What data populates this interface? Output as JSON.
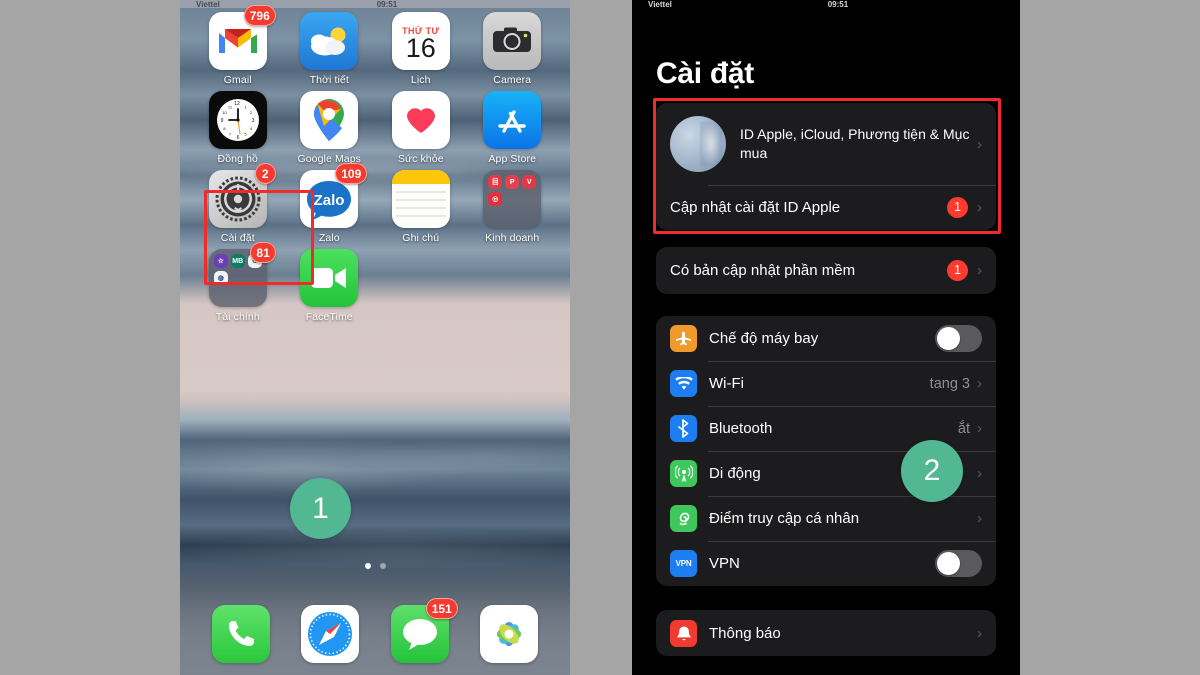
{
  "background_color": "#a5a5a5",
  "left_phone": {
    "name": "ios-home-screen",
    "status_bar": {
      "carrier": "Viettel",
      "time": "09:51",
      "battery": ""
    },
    "apps_rows": [
      [
        {
          "label": "Gmail",
          "icon": "gmail-icon",
          "badge": "796"
        },
        {
          "label": "Thời tiết",
          "icon": "weather-icon",
          "badge": ""
        },
        {
          "label": "Lịch",
          "icon": "calendar-icon",
          "badge": "",
          "cal_weekday": "THỨ TƯ",
          "cal_day": "16"
        },
        {
          "label": "Camera",
          "icon": "camera-icon",
          "badge": ""
        }
      ],
      [
        {
          "label": "Đồng hồ",
          "icon": "clock-icon",
          "badge": ""
        },
        {
          "label": "Google Maps",
          "icon": "google-maps-icon",
          "badge": ""
        },
        {
          "label": "Sức khỏe",
          "icon": "health-icon",
          "badge": ""
        },
        {
          "label": "App Store",
          "icon": "app-store-icon",
          "badge": ""
        }
      ],
      [
        {
          "label": "Cài đặt",
          "icon": "settings-gear-icon",
          "badge": "2"
        },
        {
          "label": "Zalo",
          "icon": "zalo-icon",
          "badge": "109"
        },
        {
          "label": "Ghi chú",
          "icon": "notes-icon",
          "badge": ""
        },
        {
          "label": "Kinh doanh",
          "icon": "folder-icon",
          "badge": ""
        }
      ],
      [
        {
          "label": "Tài chính",
          "icon": "folder-icon",
          "badge": "81"
        },
        {
          "label": "FaceTime",
          "icon": "facetime-icon",
          "badge": ""
        }
      ]
    ],
    "dock": [
      {
        "label": "Điện thoại",
        "icon": "phone-icon",
        "badge": ""
      },
      {
        "label": "Safari",
        "icon": "safari-compass-icon",
        "badge": ""
      },
      {
        "label": "Tin nhắn",
        "icon": "messages-icon",
        "badge": "151"
      },
      {
        "label": "Ảnh",
        "icon": "photos-icon",
        "badge": ""
      }
    ],
    "page_dots": {
      "count": 2,
      "active_index": 0
    },
    "step_badge": {
      "label": "1",
      "color": "#52b894"
    },
    "highlight_color": "#ef2b2b"
  },
  "right_phone": {
    "name": "ios-settings-screen",
    "status_bar": {
      "carrier": "Viettel",
      "time": "09:51",
      "battery": ""
    },
    "title": "Cài đặt",
    "apple_id": {
      "account_label": "ID Apple, iCloud, Phương tiện & Mục mua",
      "avatar": "profile-avatar",
      "chevron": "chevron-right-icon",
      "update_row_label": "Cập nhật cài đặt ID Apple",
      "update_row_badge": "1"
    },
    "software_update": {
      "label": "Có bản cập nhật phần mềm",
      "badge": "1"
    },
    "connectivity": [
      {
        "label": "Chế độ máy bay",
        "icon": "airplane-icon",
        "icon_color": "#f09a2b",
        "control": "toggle",
        "toggle_on": false
      },
      {
        "label": "Wi-Fi",
        "icon": "wifi-icon",
        "icon_color": "#1d7ef2",
        "control": "value",
        "value": "tang 3"
      },
      {
        "label": "Bluetooth",
        "icon": "bluetooth-icon",
        "icon_color": "#1d7ef2",
        "control": "value",
        "value": "ắt"
      },
      {
        "label": "Di động",
        "icon": "cellular-antenna-icon",
        "icon_color": "#3ec75b",
        "control": "chevron"
      },
      {
        "label": "Điểm truy cập cá nhân",
        "icon": "personal-hotspot-icon",
        "icon_color": "#3ec75b",
        "control": "chevron"
      },
      {
        "label": "VPN",
        "icon": "vpn-icon",
        "icon_color": "#1d7ef2",
        "control": "toggle",
        "toggle_on": false
      }
    ],
    "notifications": [
      {
        "label": "Thông báo",
        "icon": "notifications-bell-icon",
        "icon_color": "#f23b30",
        "control": "chevron"
      }
    ],
    "step_badge": {
      "label": "2",
      "color": "#52b894"
    },
    "highlight_color": "#ef2b2b"
  }
}
